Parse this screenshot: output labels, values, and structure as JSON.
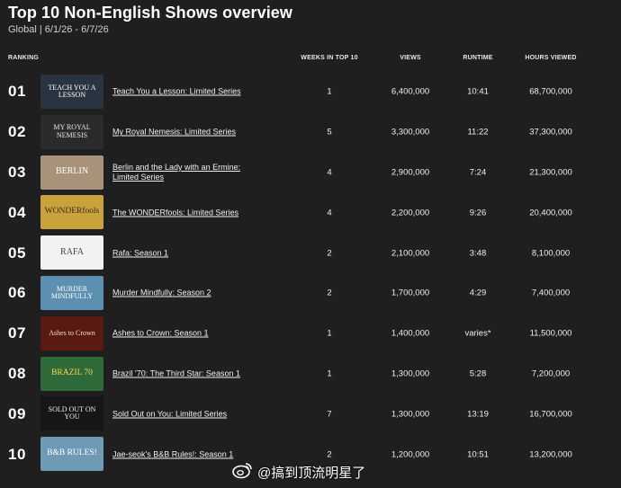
{
  "page": {
    "title": "Top 10 Non-English Shows overview",
    "subtitle": "Global | 6/1/26 - 6/7/26"
  },
  "columns": {
    "ranking": "RANKING",
    "weeks": "WEEKS IN TOP 10",
    "views": "VIEWS",
    "runtime": "RUNTIME",
    "hours": "HOURS VIEWED"
  },
  "rows": [
    {
      "rank": "01",
      "title": "Teach You a Lesson: Limited Series",
      "weeks": "1",
      "views": "6,400,000",
      "runtime": "10:41",
      "hours": "68,700,000",
      "thumb_text": "TEACH YOU A LESSON",
      "thumb_bg": "#2a3440",
      "thumb_fg": "#ffffff"
    },
    {
      "rank": "02",
      "title": "My Royal Nemesis: Limited Series",
      "weeks": "5",
      "views": "3,300,000",
      "runtime": "11:22",
      "hours": "37,300,000",
      "thumb_text": "MY ROYAL NEMESIS",
      "thumb_bg": "#2b2b2b",
      "thumb_fg": "#e6e6e6"
    },
    {
      "rank": "03",
      "title": "Berlin and the Lady with an Ermine: Limited Series",
      "weeks": "4",
      "views": "2,900,000",
      "runtime": "7:24",
      "hours": "21,300,000",
      "thumb_text": "BERLIN",
      "thumb_bg": "#a8927a",
      "thumb_fg": "#ffffff"
    },
    {
      "rank": "04",
      "title": "The WONDERfools: Limited Series",
      "weeks": "4",
      "views": "2,200,000",
      "runtime": "9:26",
      "hours": "20,400,000",
      "thumb_text": "WONDERfools",
      "thumb_bg": "#c9a23c",
      "thumb_fg": "#3a2a10"
    },
    {
      "rank": "05",
      "title": "Rafa: Season 1",
      "weeks": "2",
      "views": "2,100,000",
      "runtime": "3:48",
      "hours": "8,100,000",
      "thumb_text": "RAFA",
      "thumb_bg": "#f2f2f0",
      "thumb_fg": "#444444"
    },
    {
      "rank": "06",
      "title": "Murder Mindfully: Season 2",
      "weeks": "2",
      "views": "1,700,000",
      "runtime": "4:29",
      "hours": "7,400,000",
      "thumb_text": "MURDER MINDFULLY",
      "thumb_bg": "#5d8fb0",
      "thumb_fg": "#ffffff"
    },
    {
      "rank": "07",
      "title": "Ashes to Crown: Season 1",
      "weeks": "1",
      "views": "1,400,000",
      "runtime": "varies*",
      "hours": "11,500,000",
      "thumb_text": "Ashes to Crown",
      "thumb_bg": "#5a1a14",
      "thumb_fg": "#f3dcc0"
    },
    {
      "rank": "08",
      "title": "Brazil '70: The Third Star: Season 1",
      "weeks": "1",
      "views": "1,300,000",
      "runtime": "5:28",
      "hours": "7,200,000",
      "thumb_text": "BRAZIL 70",
      "thumb_bg": "#2f6a3a",
      "thumb_fg": "#ffd84a"
    },
    {
      "rank": "09",
      "title": "Sold Out on You: Limited Series",
      "weeks": "7",
      "views": "1,300,000",
      "runtime": "13:19",
      "hours": "16,700,000",
      "thumb_text": "SOLD OUT ON YOU",
      "thumb_bg": "#161616",
      "thumb_fg": "#f0f0f0"
    },
    {
      "rank": "10",
      "title": "Jae-seok's B&B Rules!: Season 1",
      "weeks": "2",
      "views": "1,200,000",
      "runtime": "10:51",
      "hours": "13,200,000",
      "thumb_text": "B&B RULES!",
      "thumb_bg": "#6f9ab5",
      "thumb_fg": "#ffffff"
    }
  ],
  "watermark": {
    "icon": "weibo-icon",
    "text": "@搞到顶流明星了"
  }
}
